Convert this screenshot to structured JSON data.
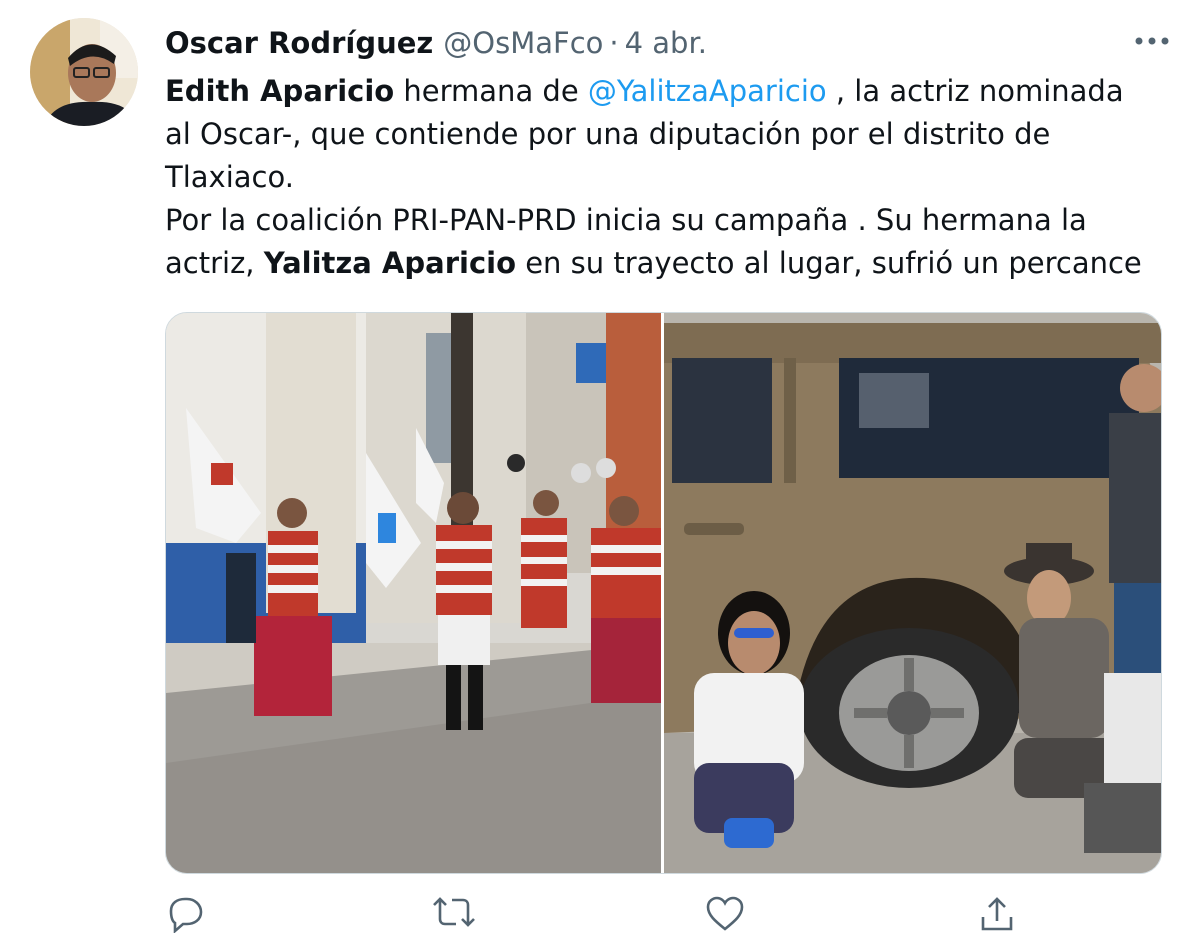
{
  "tweet": {
    "author_name": "Oscar Rodríguez",
    "author_handle": "@OsMaFco",
    "separator": "·",
    "date": "4 abr.",
    "text": {
      "line1_bold": "Edith Aparicio",
      "line1_plain": " hermana de ",
      "mention": "@YalitzaAparicio",
      "line1_rest": " , la actriz nominada",
      "line2": "al Oscar-, que contiende por una diputación por el distrito de",
      "line3": "Tlaxiaco.",
      "line4": "Por la coalición PRI-PAN-PRD inicia su campaña . Su hermana la",
      "line5_start": "actriz, ",
      "line5_bold": "Yalitza Aparicio",
      "line5_rest": " en su trayecto al lugar, sufrió un percance"
    },
    "media": [
      {
        "icon": "photo-street-march-icon"
      },
      {
        "icon": "photo-flat-tire-suv-icon"
      }
    ],
    "actions": [
      "reply-icon",
      "retweet-icon",
      "like-icon",
      "share-icon"
    ]
  },
  "colors": {
    "text": "#0f1419",
    "secondary": "#536471",
    "link": "#1d9bf0",
    "border": "#cfd9de"
  }
}
